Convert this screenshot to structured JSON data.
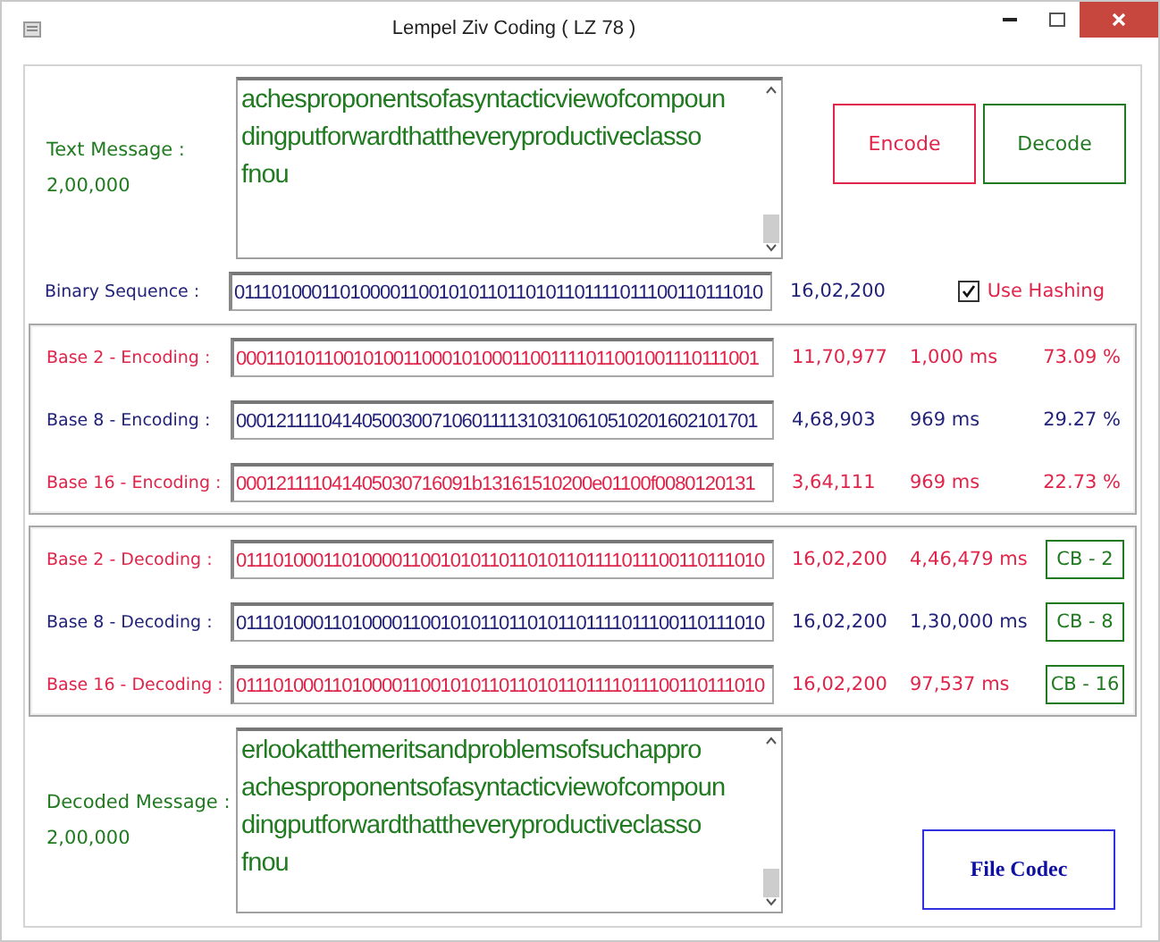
{
  "window": {
    "title": "Lempel Ziv Coding ( LZ 78 )"
  },
  "text_message": {
    "label": "Text Message :",
    "count": "2,00,000",
    "lines": [
      "achesproponentsofasyntacticviewofcompoun",
      "dingputforwardthattheveryproductiveclasso",
      "fnou"
    ]
  },
  "buttons": [
    {
      "label": "Encode",
      "color": "#e0244a"
    },
    {
      "label": "Decode",
      "color": "#207a20"
    }
  ],
  "binary_sequence": {
    "label": "Binary Sequence :",
    "value": "0111010001101000011001010110110101101111011100110111010",
    "count": "16,02,200"
  },
  "use_hashing": {
    "label": "Use Hashing",
    "checked": true
  },
  "encoding": [
    {
      "label": "Base 2 - Encoding :",
      "value": "000110101100101001100010100011001111011001001110111001",
      "count": "11,70,977",
      "time": "1,000 ms",
      "ratio": "73.09 %",
      "color": "#e0244a"
    },
    {
      "label": "Base 8 - Encoding :",
      "value": "00012111104140500300710601111310310610510201602101701",
      "count": "4,68,903",
      "time": "969 ms",
      "ratio": "29.27 %",
      "color": "#23237a"
    },
    {
      "label": "Base 16 - Encoding :",
      "value": "000121111041405030716091b13161510200e01100f0080120131",
      "count": "3,64,111",
      "time": "969 ms",
      "ratio": "22.73 %",
      "color": "#e0244a"
    }
  ],
  "decoding": [
    {
      "label": "Base 2 - Decoding :",
      "value": "0111010001101000011001010110110101101111011100110111010",
      "count": "16,02,200",
      "time": "4,46,479 ms",
      "button": "CB - 2",
      "color": "#e0244a"
    },
    {
      "label": "Base 8 - Decoding :",
      "value": "0111010001101000011001010110110101101111011100110111010",
      "count": "16,02,200",
      "time": "1,30,000 ms",
      "button": "CB - 8",
      "color": "#23237a"
    },
    {
      "label": "Base 16 - Decoding :",
      "value": "0111010001101000011001010110110101101111011100110111010",
      "count": "16,02,200",
      "time": "97,537 ms",
      "button": "CB - 16",
      "color": "#e0244a"
    }
  ],
  "decoded_message": {
    "label": "Decoded Message :",
    "count": "2,00,000",
    "lines": [
      "erlookatthemeritsandproblemsofsuchappro",
      "achesproponentsofasyntacticviewofcompoun",
      "dingputforwardthattheveryproductiveclasso",
      "fnou"
    ]
  },
  "file_codec_button": {
    "label": "File Codec"
  }
}
